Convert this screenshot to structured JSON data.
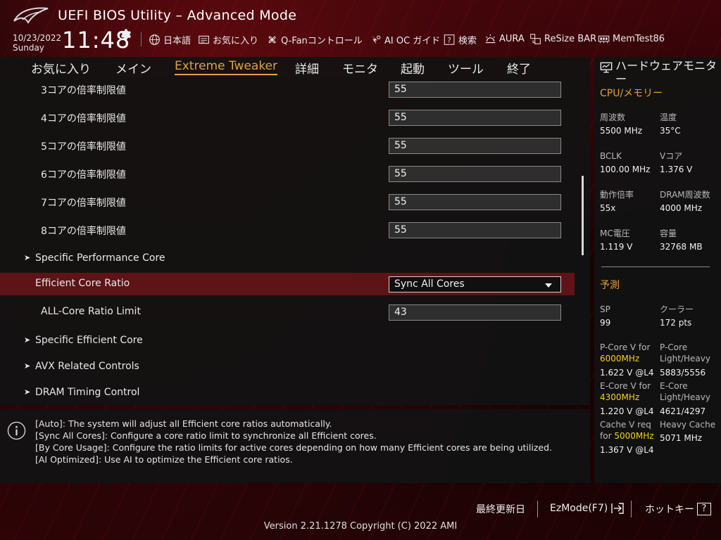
{
  "header": {
    "title": "UEFI BIOS Utility – Advanced Mode",
    "date": "10/23/2022",
    "weekday": "Sunday",
    "time": "11:48",
    "tools": [
      {
        "label": "日本語",
        "icon": "globe-icon"
      },
      {
        "label": "お気に入り",
        "icon": "favorites-icon"
      },
      {
        "label": "Q-Fanコントロール",
        "icon": "fan-icon"
      },
      {
        "label": "AI OC ガイド",
        "icon": "ai-oc-icon"
      },
      {
        "label": "検索",
        "icon": "search-icon"
      },
      {
        "label": "AURA",
        "icon": "aura-icon"
      },
      {
        "label": "ReSize BAR",
        "icon": "resize-bar-icon"
      },
      {
        "label": "MemTest86",
        "icon": "memtest-icon"
      }
    ]
  },
  "nav": {
    "tabs": [
      "お気に入り",
      "メイン",
      "Extreme Tweaker",
      "詳細",
      "モニタ",
      "起動",
      "ツール",
      "終了"
    ],
    "active": "Extreme Tweaker"
  },
  "settings": {
    "rows": [
      {
        "label": "3コアの倍率制限値",
        "value": "55"
      },
      {
        "label": "4コアの倍率制限値",
        "value": "55"
      },
      {
        "label": "5コアの倍率制限値",
        "value": "55"
      },
      {
        "label": "6コアの倍率制限値",
        "value": "55"
      },
      {
        "label": "7コアの倍率制限値",
        "value": "55"
      },
      {
        "label": "8コアの倍率制限値",
        "value": "55"
      },
      {
        "label": "Specific Performance Core"
      },
      {
        "label": "Efficient Core Ratio",
        "value": "Sync All Cores"
      },
      {
        "label": "ALL-Core Ratio Limit",
        "value": "43"
      },
      {
        "label": "Specific Efficient Core"
      },
      {
        "label": "AVX Related Controls"
      },
      {
        "label": "DRAM Timing Control"
      }
    ]
  },
  "help": {
    "lines": [
      "[Auto]: The system will adjust all Efficient core ratios automatically.",
      "[Sync All Cores]: Configure a core ratio limit to synchronize all Efficient cores.",
      "[By Core Usage]: Configure the ratio limits for active cores depending on how many Efficient cores are being utilized.",
      "[AI Optimized]: Use AI to optimize the Efficient core ratios."
    ]
  },
  "hw_monitor": {
    "title": "ハードウェアモニター",
    "cpu_section": "CPU/メモリー",
    "cpu_items": [
      {
        "label": "周波数",
        "value": "5500 MHz"
      },
      {
        "label": "温度",
        "value": "35°C"
      },
      {
        "label": "BCLK",
        "value": "100.00 MHz"
      },
      {
        "label": "Vコア",
        "value": "1.376 V"
      },
      {
        "label": "動作倍率",
        "value": "55x"
      },
      {
        "label": "DRAM周波数",
        "value": "4000 MHz"
      },
      {
        "label": "MC電圧",
        "value": "1.119 V"
      },
      {
        "label": "容量",
        "value": "32768 MB"
      }
    ],
    "predict_section": "予測",
    "sp_label": "SP",
    "sp_value": "99",
    "cooler_label": "クーラー",
    "cooler_value": "172 pts",
    "pcore_v_label": "P-Core V for",
    "pcore_v_freq": "6000MHz",
    "pcore_v_value": "1.622 V @L4",
    "pcore_lh_label": "P-Core Light/Heavy",
    "pcore_lh_value": "5883/5556",
    "ecore_v_label": "E-Core V for",
    "ecore_v_freq": "4300MHz",
    "ecore_v_value": "1.220 V @L4",
    "ecore_lh_label": "E-Core Light/Heavy",
    "ecore_lh_value": "4621/4297",
    "cache_v_label1": "Cache V req",
    "cache_v_label2": "for",
    "cache_v_freq": "5000MHz",
    "cache_v_value": "1.367 V @L4",
    "heavy_cache_label": "Heavy Cache",
    "heavy_cache_value": "5071 MHz"
  },
  "footer": {
    "last_modified": "最終更新日",
    "ezmode": "EzMode(F7)",
    "hotkeys": "ホットキー",
    "hotkey_glyph": "?",
    "version": "Version 2.21.1278 Copyright (C) 2022 AMI"
  },
  "colors": {
    "accent": "#e5a13a",
    "highlight": "#f2d01e",
    "selected_row": "#5e1417"
  }
}
